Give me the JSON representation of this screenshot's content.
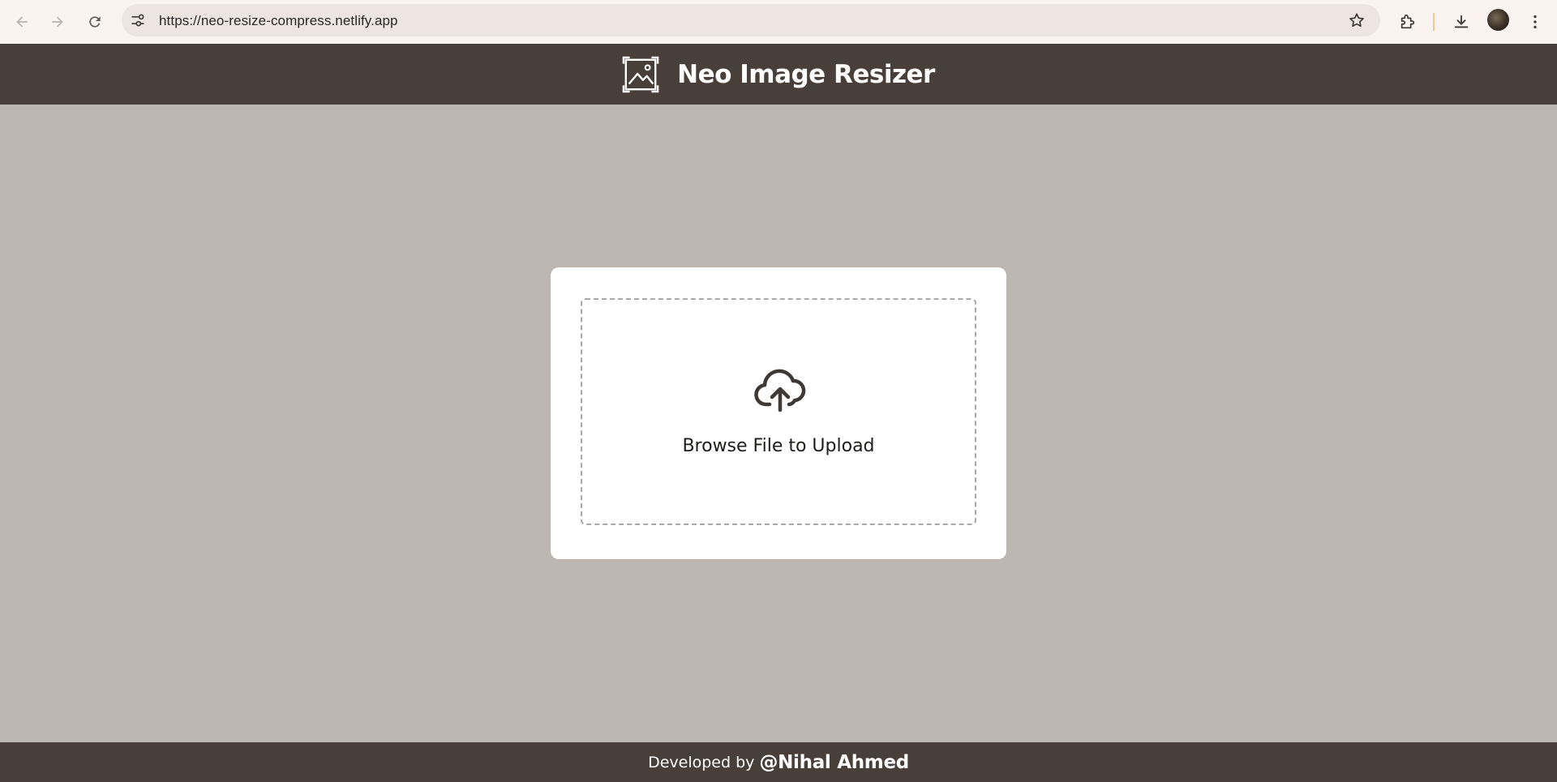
{
  "browser": {
    "url": "https://neo-resize-compress.netlify.app",
    "icons": {
      "back": "arrow-left-icon",
      "forward": "arrow-right-icon",
      "reload": "reload-icon",
      "site_info": "tune-icon",
      "bookmark": "star-icon",
      "extensions": "puzzle-icon",
      "downloads": "download-icon",
      "menu": "kebab-menu-icon"
    }
  },
  "header": {
    "title": "Neo Image Resizer",
    "logo_icon": "image-resize-icon"
  },
  "upload": {
    "icon": "cloud-upload-icon",
    "label": "Browse File to Upload"
  },
  "footer": {
    "prefix": "Developed by",
    "author": "@Nihal Ahmed"
  },
  "colors": {
    "header_bg": "#483f3a",
    "page_bg": "#bcb7b0",
    "card_bg": "#ffffff",
    "browser_bg": "#fbf3ef",
    "omnibox_bg": "#efe5e0"
  }
}
